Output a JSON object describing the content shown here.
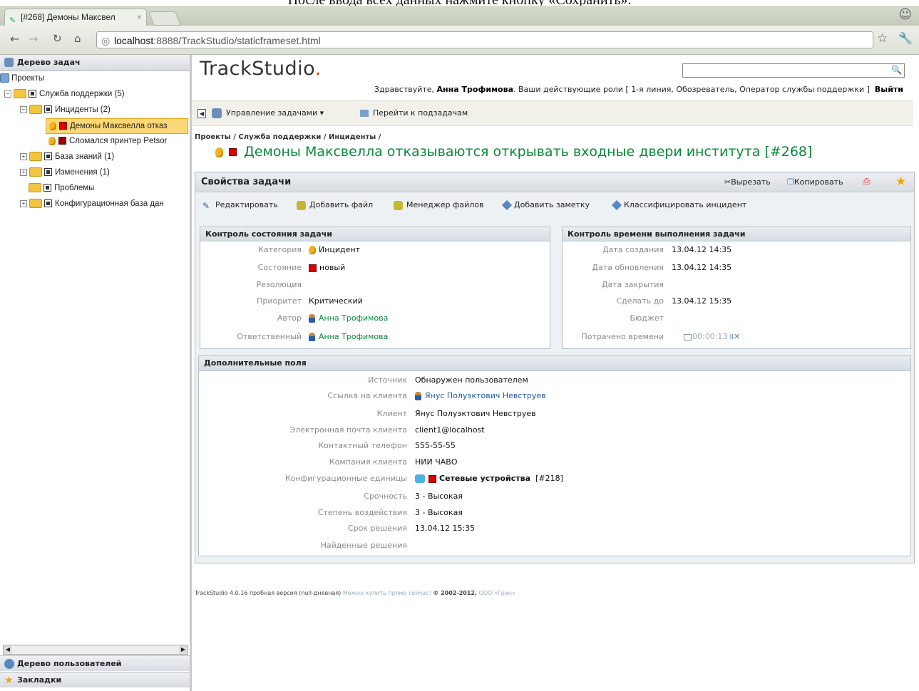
{
  "doc_caption": "После ввода всех данных нажмите кнопку «Сохранить».",
  "browser": {
    "tab_title": "[#268] Демоны Максвел",
    "url_host": "localhost",
    "url_rest": ":8888/TrackStudio/staticframeset.html"
  },
  "sidebar": {
    "tree_title": "Дерево задач",
    "nodes": [
      "Проекты",
      "Служба поддержки (5)",
      "Инциденты (2)",
      "Демоны Максвелла отказ",
      "Сломался принтер Petsor",
      "База знаний (1)",
      "Изменения (1)",
      "Проблемы",
      "Конфигурационная база дан"
    ],
    "users_title": "Дерево пользователей",
    "bookmarks_title": "Закладки"
  },
  "header": {
    "logo": "TrackStudio",
    "logo_dot": ".",
    "greet_prefix": "Здравствуйте,",
    "user_name": "Анна Трофимова",
    "greet_roles": ". Ваши действующие роли  [ 1-я линия, Обозреватель, Оператор службы поддержки ]",
    "logout": "Выйти"
  },
  "toolbar": {
    "manage": "Управление задачами",
    "goto_subtasks": "Перейти к подзадачам"
  },
  "task": {
    "breadcrumb": "Проекты / Служба поддержки / Инциденты /",
    "title": "Демоны Максвелла отказываются открывать входные двери института  [#268]"
  },
  "panel": {
    "title": "Свойства задачи",
    "cut": "Вырезать",
    "copy": "Копировать",
    "actions": [
      "Редактировать",
      "Добавить файл",
      "Менеджер файлов",
      "Добавить заметку",
      "Классифицировать инцидент"
    ]
  },
  "state_box": {
    "title": "Контроль состояния задачи",
    "rows": [
      {
        "label": "Категория",
        "value": "Инцидент"
      },
      {
        "label": "Состояние",
        "value": "новый"
      },
      {
        "label": "Резолюция",
        "value": ""
      },
      {
        "label": "Приоритет",
        "value": "Критический"
      },
      {
        "label": "Автор",
        "value": "Анна Трофимова"
      },
      {
        "label": "Ответственный",
        "value": "Анна Трофимова"
      }
    ]
  },
  "time_box": {
    "title": "Контроль времени выполнения задачи",
    "rows": [
      {
        "label": "Дата создания",
        "value": "13.04.12 14:35"
      },
      {
        "label": "Дата обновления",
        "value": "13.04.12 14:35"
      },
      {
        "label": "Дата закрытия",
        "value": ""
      },
      {
        "label": "Сделать до",
        "value": "13.04.12 15:35"
      },
      {
        "label": "Бюджет",
        "value": ""
      },
      {
        "label": "Потрачено времени",
        "value": "00:00:13"
      }
    ]
  },
  "extra_box": {
    "title": "Дополнительные поля",
    "rows": [
      {
        "label": "Источник",
        "value": "Обнаружен пользователем"
      },
      {
        "label": "Ссылка на клиента",
        "value": "Янус Полуэктович Невструев"
      },
      {
        "label": "Клиент",
        "value": "Янус Полуэктович Невструев"
      },
      {
        "label": "Электронная почта клиента",
        "value": "client1@localhost"
      },
      {
        "label": "Контактный телефон",
        "value": "555-55-55"
      },
      {
        "label": "Компания клиента",
        "value": "НИИ ЧАВО"
      },
      {
        "label": "Конфигурационные единицы",
        "value": "Сетевые устройства",
        "extra": "[#218]"
      },
      {
        "label": "Срочность",
        "value": "3 - Высокая"
      },
      {
        "label": "Степень воздействия",
        "value": "3 - Высокая"
      },
      {
        "label": "Срок решения",
        "value": "13.04.12 15:35"
      },
      {
        "label": "Найденные решения",
        "value": ""
      }
    ]
  },
  "footer": {
    "text": "TrackStudio 4.0.16 пробная версия (null-дневная)",
    "buy": "Можно купить прямо сейчас!",
    "copyright": "© 2002-2012,",
    "company": "ООО «Гран»"
  },
  "colors": {
    "accent_green": "#0a8a3a",
    "link_blue": "#1d5aa8",
    "state_red": "#dd0000",
    "bulb": "#f3b21d"
  }
}
